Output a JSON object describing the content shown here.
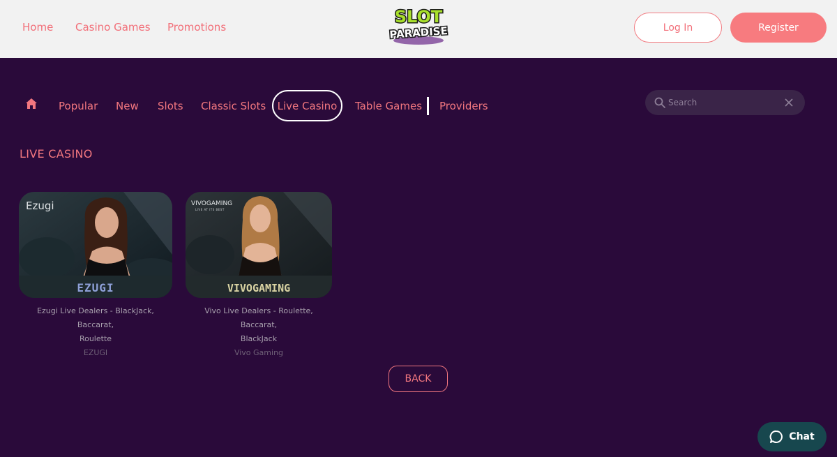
{
  "header": {
    "nav": [
      "Home",
      "Casino Games",
      "Promotions"
    ],
    "logo_top": "SLOT",
    "logo_bottom": "PARADISE",
    "login": "Log In",
    "register": "Register"
  },
  "categories": {
    "items": [
      "Popular",
      "New",
      "Slots",
      "Classic Slots",
      "Live Casino",
      "Table Games",
      "Providers"
    ],
    "active": "Live Casino"
  },
  "search": {
    "placeholder": "Search"
  },
  "section_title": "LIVE CASINO",
  "games": [
    {
      "brand_logo": "Ezugi",
      "banner": "EZUGI",
      "caption_line1": "Ezugi Live Dealers - BlackJack, Baccarat,",
      "caption_line2": "Roulette",
      "provider": "EZUGI"
    },
    {
      "brand_logo": "VIVOGAMING",
      "brand_tagline": "LIVE AT ITS BEST",
      "banner": "VIVOGAMING",
      "caption_line1": "Vivo Live Dealers - Roulette, Baccarat,",
      "caption_line2": "BlackJack",
      "provider": "Vivo Gaming"
    }
  ],
  "back": "BACK",
  "chat": "Chat",
  "colors": {
    "accent": "#f2777f",
    "background": "#2a0a3a",
    "header": "#f2f2f2",
    "chat": "#17474e"
  }
}
